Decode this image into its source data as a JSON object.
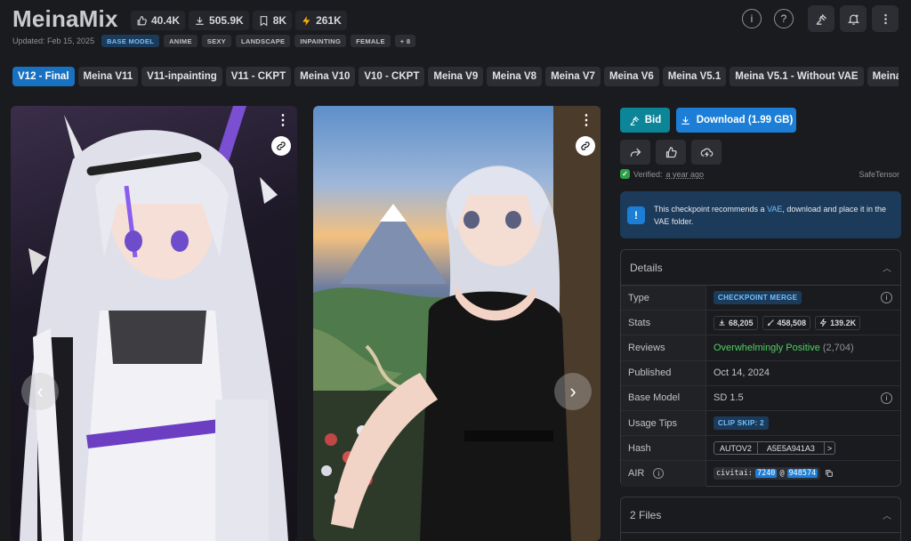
{
  "header": {
    "title": "MeinaMix",
    "stats": {
      "likes": "40.4K",
      "downloads": "505.9K",
      "bookmarks": "8K",
      "buzz": "261K"
    },
    "updated": "Updated: Feb 15, 2025",
    "base_tag": "BASE MODEL",
    "tags": [
      "ANIME",
      "SEXY",
      "LANDSCAPE",
      "INPAINTING",
      "FEMALE",
      "+ 8"
    ],
    "icons": [
      "info-icon",
      "help-icon",
      "gavel-icon",
      "bell-plus-icon",
      "more-vertical-icon"
    ]
  },
  "versions": [
    "V12 - Final",
    "Meina V11",
    "V11-inpainting",
    "V11 - CKPT",
    "Meina V10",
    "V10 - CKPT",
    "Meina V9",
    "Meina V8",
    "Meina V7",
    "Meina V6",
    "Meina V5.1",
    "Meina V5.1 - Without VAE",
    "Meina V5",
    "Me"
  ],
  "gallery": {
    "prev_icon": "‹",
    "next_icon": "›",
    "menu_icon": "⋮"
  },
  "actions": {
    "bid_label": "Bid",
    "download_label": "Download (1.99 GB)"
  },
  "verified": {
    "prefix": "Verified:",
    "time": "a year ago",
    "format": "SafeTensor"
  },
  "notice": {
    "before": "This checkpoint recommends a ",
    "link": "VAE",
    "after": ", download and place it in the VAE folder."
  },
  "details": {
    "title": "Details",
    "type_label": "Type",
    "type_value": "CHECKPOINT MERGE",
    "stats_label": "Stats",
    "stat_downloads": "68,205",
    "stat_generations": "458,508",
    "stat_buzz": "139.2K",
    "reviews_label": "Reviews",
    "reviews_value": "Overwhelmingly Positive",
    "reviews_count": "(2,704)",
    "published_label": "Published",
    "published_value": "Oct 14, 2024",
    "base_label": "Base Model",
    "base_value": "SD 1.5",
    "tips_label": "Usage Tips",
    "tips_value": "CLIP SKIP: 2",
    "hash_label": "Hash",
    "hash_algo": "AUTOV2",
    "hash_value": "A5E5A941A3",
    "hash_arrow": ">",
    "air_label": "AIR",
    "air_prefix": "civitai:",
    "air_model": "7240",
    "air_at": "@",
    "air_version": "948574"
  },
  "files": {
    "title": "2 Files"
  },
  "colors": {
    "accent": "#1971c2",
    "teal": "#0c8599",
    "positive": "#51cf66",
    "bg": "#1a1b1e"
  }
}
